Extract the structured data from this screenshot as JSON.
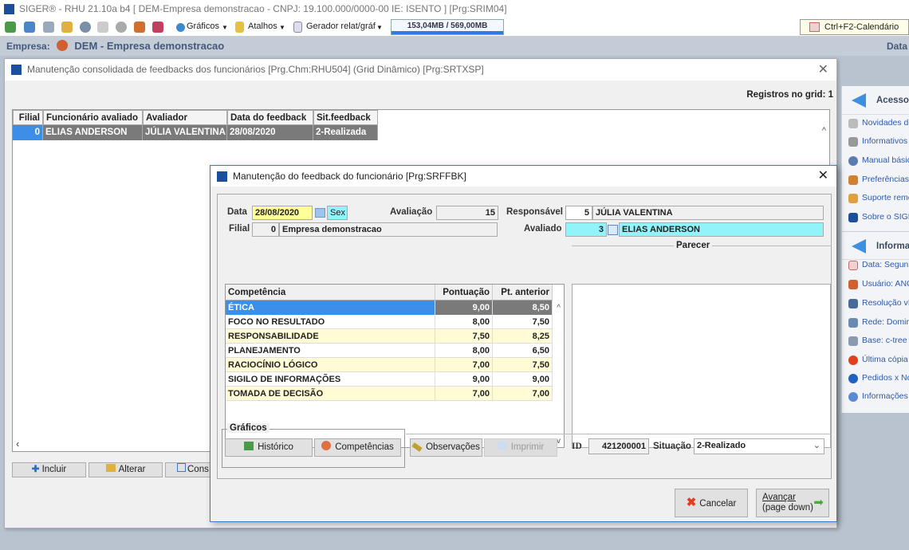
{
  "app": {
    "title": "SIGER® - RHU 21.10a b4 [ DEM-Empresa demonstracao - CNPJ: 19.100.000/0000-00 IE: ISENTO ] [Prg:SRIM04]",
    "toolbar": {
      "graficos": "Gráficos",
      "atalhos": "Atalhos",
      "gerador": "Gerador relat/gráf",
      "memory": "153,04MB / 569,00MB",
      "memory_fraction": 0.27,
      "calendar": "Ctrl+F2-Calendário"
    },
    "empresa_label": "Empresa:",
    "empresa": "DEM - Empresa demonstracao",
    "data_label": "Data"
  },
  "main": {
    "title": "Manutenção consolidada de feedbacks dos funcionários [Prg.Chm:RHU504] (Grid Dinâmico) [Prg:SRTXSP]",
    "records": "Registros no grid: 1",
    "columns": [
      "Filial",
      "Funcionário avaliado",
      "Avaliador",
      "Data do feedback",
      "Sit.feedback"
    ],
    "rows": [
      [
        "0",
        "ELIAS ANDERSON",
        "JÚLIA VALENTINA",
        "28/08/2020",
        "2-Realizada"
      ]
    ],
    "buttons": {
      "incluir": "Incluir",
      "alterar": "Alterar",
      "consultar": "Cons"
    }
  },
  "side": {
    "acesso": "Acesso",
    "acesso_items": [
      "Novidades de",
      "Informativos",
      "Manual básico",
      "Preferências",
      "Suporte remo",
      "Sobre o SIGE"
    ],
    "info": "Informa",
    "info_items": [
      "Data: Segun",
      "Usuário: ANG",
      "Resolução víd",
      "Rede: Domini",
      "Base: c-tree",
      "Última cópia d",
      "Pedidos x No",
      "Informações"
    ]
  },
  "dialog": {
    "title": "Manutenção do feedback do funcionário [Prg:SRFFBK]",
    "data_label": "Data",
    "data": "28/08/2020",
    "dia": "Sex",
    "avaliacao_label": "Avaliação",
    "avaliacao": "15",
    "responsavel_label": "Responsável",
    "responsavel_cod": "5",
    "responsavel": "JÚLIA VALENTINA",
    "filial_label": "Filial",
    "filial_cod": "0",
    "filial": "Empresa demonstracao",
    "avaliado_label": "Avaliado",
    "avaliado_cod": "3",
    "avaliado": "ELIAS ANDERSON",
    "parecer_label": "Parecer",
    "comp_columns": [
      "Competência",
      "Pontuação",
      "Pt. anterior"
    ],
    "competencias": [
      [
        "ÉTICA",
        "9,00",
        "8,50"
      ],
      [
        "FOCO NO RESULTADO",
        "8,00",
        "7,50"
      ],
      [
        "RESPONSABILIDADE",
        "7,50",
        "8,25"
      ],
      [
        "PLANEJAMENTO",
        "8,00",
        "6,50"
      ],
      [
        "RACIOCÍNIO LÓGICO",
        "7,00",
        "7,50"
      ],
      [
        "SIGILO DE INFORMAÇÕES",
        "9,00",
        "9,00"
      ],
      [
        "TOMADA DE DECISÃO",
        "7,00",
        "7,00"
      ]
    ],
    "graficos_label": "Gráficos",
    "historico": "Histórico",
    "competencias_btn": "Competências",
    "observacoes": "Observações",
    "imprimir": "Imprimir",
    "id_label": "ID",
    "id": "421200001",
    "situacao_label": "Situação",
    "situacao": "2-Realizado",
    "cancelar": "Cancelar",
    "avancar": "Avançar",
    "avancar_sub": "(page down)"
  }
}
